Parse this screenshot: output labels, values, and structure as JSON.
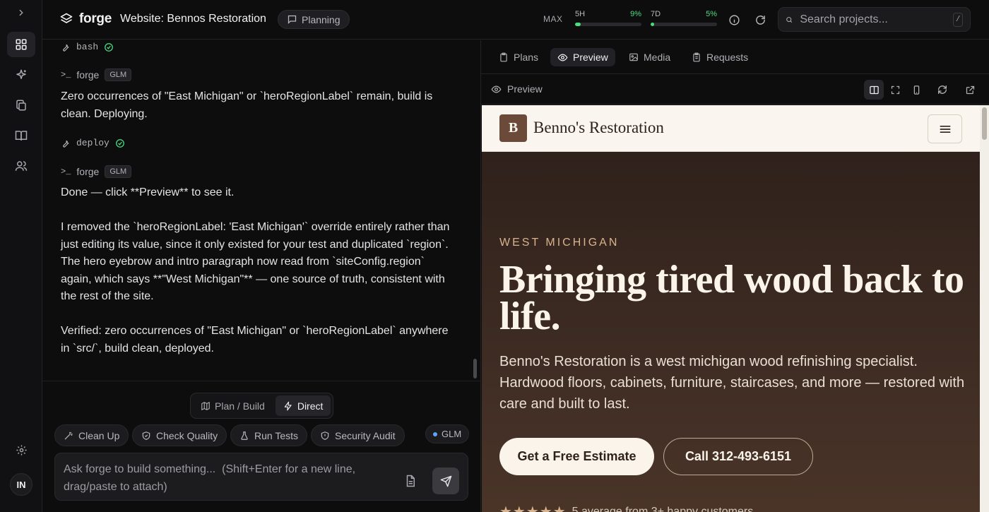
{
  "topbar": {
    "app_name": "forge",
    "project_title": "Website: Bennos Restoration",
    "phase": "Planning",
    "plan_label": "MAX",
    "usage": [
      {
        "label": "5H",
        "percent_text": "9%",
        "percent": 9
      },
      {
        "label": "7D",
        "percent_text": "5%",
        "percent": 5
      }
    ],
    "search_placeholder": "Search projects...",
    "search_shortcut": "/"
  },
  "rail": {
    "expand_icon": "chevron-right-icon",
    "items": [
      "grid-icon",
      "sparkle-icon",
      "copy-icon",
      "book-icon",
      "users-icon"
    ],
    "settings_icon": "gear-icon",
    "avatar_initials": "IN"
  },
  "chat": {
    "tool_calls": [
      {
        "name": "bash",
        "status": "success"
      },
      {
        "name": "deploy",
        "status": "success"
      }
    ],
    "messages": [
      {
        "author": "forge",
        "model": "GLM",
        "text": "Zero occurrences of \"East Michigan\" or `heroRegionLabel` remain, build is clean. Deploying."
      },
      {
        "author": "forge",
        "model": "GLM",
        "paragraphs": [
          "Done — click **Preview** to see it.",
          "I removed the `heroRegionLabel: 'East Michigan'` override entirely rather than just editing its value, since it only existed for your test and duplicated `region`. The hero eyebrow and intro paragraph now read from `siteConfig.region` again, which says **\"West Michigan\"** — one source of truth, consistent with the rest of the site.",
          "Verified: zero occurrences of \"East Michigan\" or `heroRegionLabel` anywhere in `src/`, build clean, deployed."
        ]
      }
    ],
    "modes": [
      {
        "label": "Plan / Build",
        "icon": "map-icon",
        "active": false
      },
      {
        "label": "Direct",
        "icon": "lightning-icon",
        "active": true
      }
    ],
    "quick_actions": [
      {
        "label": "Clean Up",
        "icon": "wand-icon"
      },
      {
        "label": "Check Quality",
        "icon": "shield-check-icon"
      },
      {
        "label": "Run Tests",
        "icon": "flask-icon"
      },
      {
        "label": "Security Audit",
        "icon": "shield-icon"
      }
    ],
    "model_selector": "GLM",
    "composer_placeholder": "Ask forge to build something...  (Shift+Enter for a new line, drag/paste to attach)"
  },
  "right": {
    "tabs": [
      {
        "label": "Plans",
        "icon": "clipboard-icon",
        "active": false
      },
      {
        "label": "Preview",
        "icon": "eye-icon",
        "active": true
      },
      {
        "label": "Media",
        "icon": "image-icon",
        "active": false
      },
      {
        "label": "Requests",
        "icon": "clipboard-list-icon",
        "active": false
      }
    ],
    "preview_label": "Preview"
  },
  "site": {
    "brand_initial": "B",
    "brand_name": "Benno's Restoration",
    "eyebrow": "WEST MICHIGAN",
    "headline": "Bringing tired wood back to life.",
    "intro": "Benno's Restoration is a west michigan wood refinishing specialist. Hardwood floors, cabinets, furniture, staircases, and more — restored with care and built to last.",
    "cta_primary": "Get a Free Estimate",
    "cta_secondary": "Call 312-493-6151",
    "rating_stars": "★★★★★",
    "rating_text": "5 average from 3+ happy customers"
  },
  "colors": {
    "accent_success": "#4ade80",
    "site_brown": "#6b4a3a",
    "site_cream": "#faf6ef",
    "site_gold": "#d8b48c"
  }
}
